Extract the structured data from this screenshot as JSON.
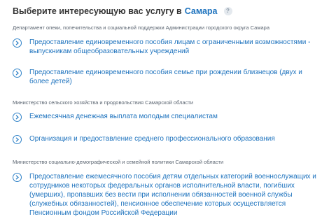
{
  "header": {
    "title": "Выберите интересующую вас услугу в",
    "city": "Самара",
    "help_icon": "?"
  },
  "groups": [
    {
      "department": "Департамент опеки, попечительства и социальной поддержки Администрации городского округа Самара",
      "services": [
        "Предоставление единовременного пособия лицам с ограниченными возможностями - выпускникам общеобразовательных учреждений",
        "Предоставление единовременного пособия семье при рождении близнецов (двух и более детей)"
      ]
    },
    {
      "department": "Министерство сельского хозяйства и продовольствия Самарской области",
      "services": [
        "Ежемесячная денежная выплата молодым специалистам",
        "Организация и предоставление среднего профессионального образования"
      ]
    },
    {
      "department": "Министерство социально-демографической и семейной политики Самарской области",
      "services": [
        "Предоставление ежемесячного пособия детям отдельных категорий военнослужащих и сотрудников некоторых федеральных органов исполнительной власти, погибших (умерших), пропавших без вести при исполнении обязанностей военной службы (служебных обязанностей), пенсионное обеспечение которых осуществляется Пенсионным фондом Российской Федерации"
      ]
    }
  ],
  "colors": {
    "link": "#1e73be",
    "title": "#333333",
    "muted": "#5a6470"
  },
  "icons": {
    "service": "chevron-right-circle-icon",
    "help": "question-icon"
  }
}
